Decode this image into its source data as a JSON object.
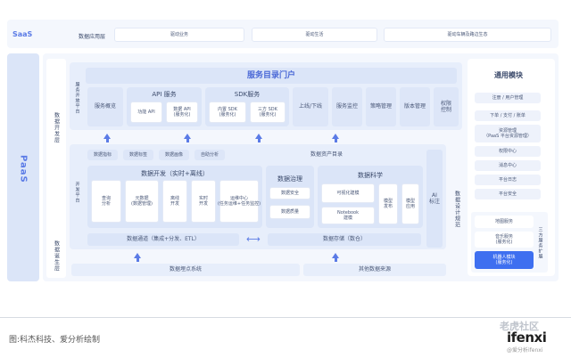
{
  "saas": {
    "label": "SaaS",
    "category": "数据应用层",
    "items": [
      "驱动业务",
      "驱动生活",
      "驱动车辆及路边生态"
    ]
  },
  "paas": {
    "label": "PaaS",
    "layer_dev": "数据开发层",
    "layer_gen": "数据诞生层",
    "open_platform": "服务开放平台",
    "dev_platform": "开发平台"
  },
  "portal": {
    "title": "服务目录门户",
    "overview": "服务概览",
    "api_title": "API 服务",
    "api_items": [
      "功能 API",
      "数据 API\n(服务化)"
    ],
    "sdk_title": "SDK服务",
    "sdk_items": [
      "内置 SDK\n(服务化)",
      "三方 SDK\n(服务化)"
    ],
    "ops": [
      "上线/下线",
      "服务监控",
      "策略管理",
      "版本管理",
      "权限控制"
    ]
  },
  "data_assets": {
    "tags": [
      "数据指标",
      "数据标签",
      "数据画像",
      "自助分析"
    ],
    "catalog": "数据资产目录"
  },
  "data_dev": {
    "title": "数据开发（实时+离线）",
    "items": [
      "查询\n分析",
      "元数据\n(数据管理)",
      "离线\n开发",
      "实时\n开发",
      "运维中心\n(任务运维+任务监控)"
    ]
  },
  "governance": {
    "title": "数据治理",
    "items": [
      "数据安全",
      "数据质量"
    ]
  },
  "data_science": {
    "title": "数据科学",
    "items": [
      "可视化建模",
      "Notebook\n建模",
      "模型\n发布",
      "模型\n应用"
    ]
  },
  "ai": "AI\n标注",
  "channel": {
    "left": "数据通道（集成+分发、ETL）",
    "right": "数据存储（数仓）"
  },
  "sources": [
    "数据埋点系统",
    "其他数据来源"
  ],
  "design_spec": "数据设计规范",
  "general": {
    "title": "通用模块",
    "items": [
      "注册 / 用户管理",
      "下单 / 支付 / 账单",
      "资源管理\n（PaaS 平台资源管理）",
      "权限中心",
      "消息中心",
      "平台日志",
      "平台安全"
    ],
    "lower_items": [
      "地图服务",
      "音乐服务\n(服务化)",
      "机器人模块\n(服务化)"
    ],
    "third_party": "三方服务扩展"
  },
  "caption": "图:科杰科技、爱分析绘制",
  "watermark": {
    "brand": "老虎社区",
    "logo": "ifenxi",
    "sub": "@爱分析ifenxi"
  },
  "colors": {
    "highlight": "#3e6ff0",
    "saas_text": "#5b7be6",
    "arrow": "#5b7be6"
  }
}
